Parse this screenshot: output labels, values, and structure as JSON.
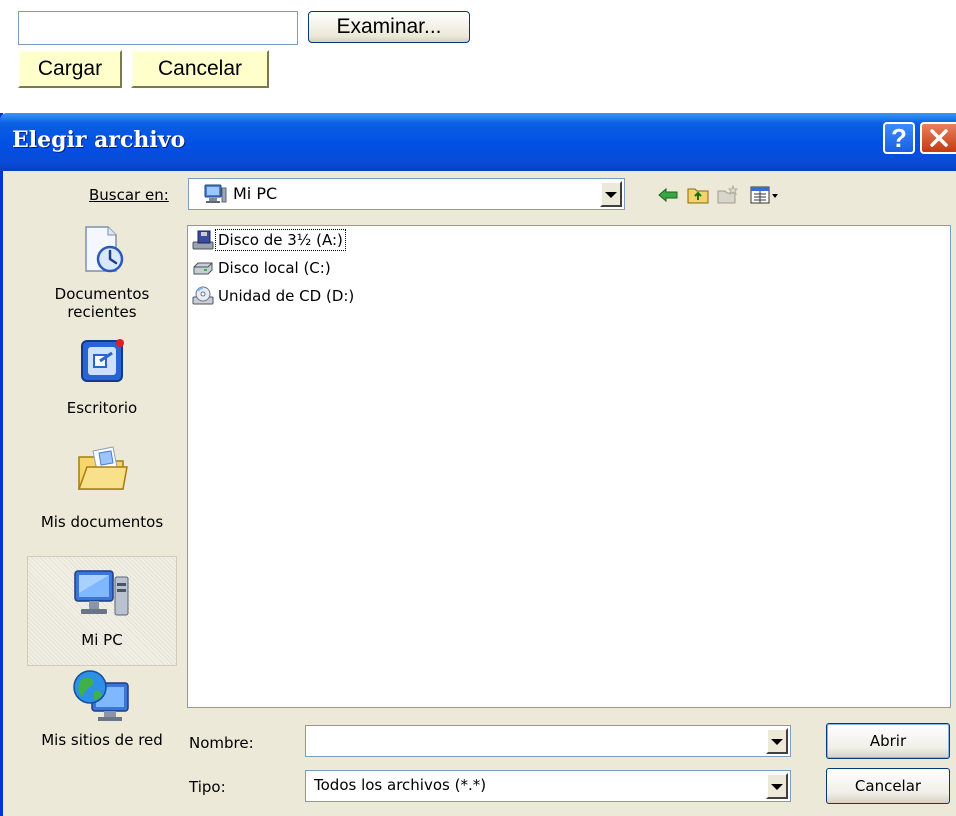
{
  "upload_form": {
    "file_input_value": "",
    "browse_label": "Examinar...",
    "load_label": "Cargar",
    "cancel_label": "Cancelar"
  },
  "dialog": {
    "title": "Elegir archivo",
    "help_label": "?",
    "look_in_label": "Buscar en:",
    "look_in_value": "Mi PC",
    "toolbar": {
      "icons": [
        "back-arrow-icon",
        "up-folder-icon",
        "new-folder-icon",
        "view-menu-icon"
      ]
    },
    "places": [
      {
        "label_line1": "Documentos",
        "label_line2": "recientes",
        "icon": "recent-documents-icon"
      },
      {
        "label_line1": "Escritorio",
        "icon": "desktop-icon"
      },
      {
        "label_line1": "Mis documentos",
        "icon": "my-documents-icon"
      },
      {
        "label_line1": "Mi PC",
        "icon": "my-computer-icon",
        "selected": true
      },
      {
        "label_line1": "Mis sitios de red",
        "icon": "network-places-icon"
      }
    ],
    "files": [
      {
        "name": "Disco de 3½ (A:)",
        "icon": "floppy-drive-icon",
        "focused": true
      },
      {
        "name": "Disco local (C:)",
        "icon": "hard-drive-icon"
      },
      {
        "name": "Unidad de CD (D:)",
        "icon": "cd-drive-icon"
      }
    ],
    "filename_label": "Nombre:",
    "filename_value": "",
    "filetype_label": "Tipo:",
    "filetype_value": "Todos los archivos (*.*)",
    "open_label": "Abrir",
    "cancel_label": "Cancelar",
    "colors": {
      "titlebar": "#0a5fe2",
      "dialog_bg": "#ece9d8",
      "form_button_bg": "#ffffcc"
    }
  }
}
